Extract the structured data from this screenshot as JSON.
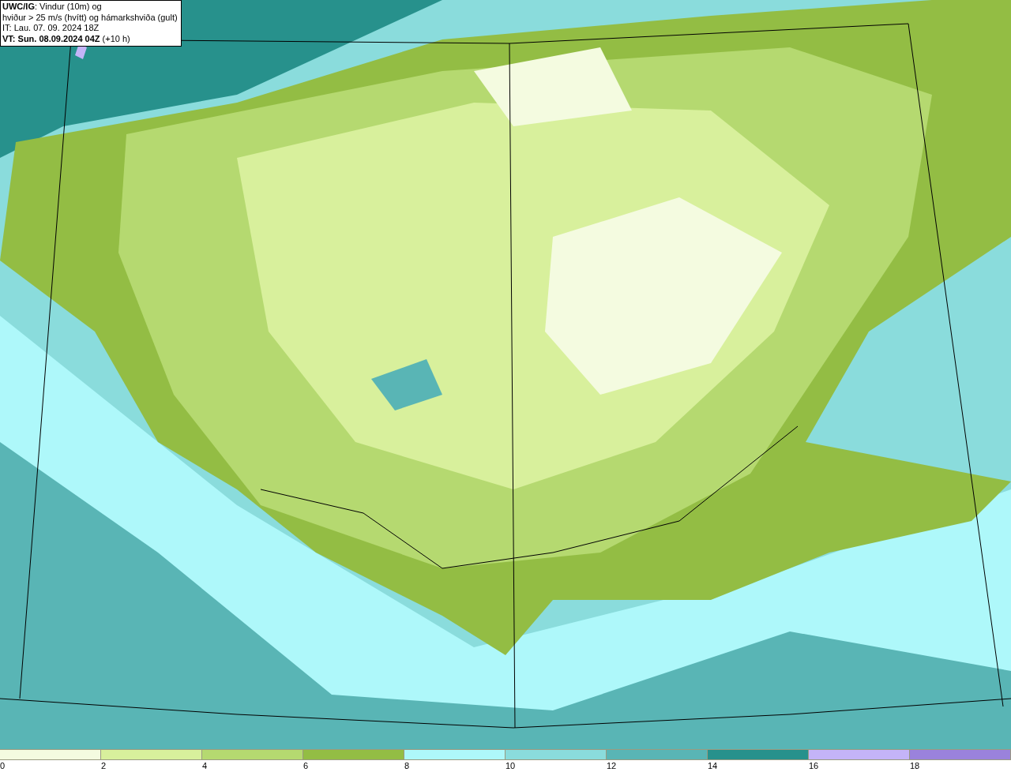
{
  "header": {
    "lines": [
      "**UWC/IG**: Vindur (10m) og",
      "hviður > 25 m/s (hvítt) og hámarkshviða (gult)",
      "IT: Lau. 07. 09. 2024 18Z",
      "**VT: Sun. 08.09.2024 04Z** (+10 h)"
    ]
  },
  "legend": [
    {
      "label": "0",
      "color": "#f4fbe0"
    },
    {
      "label": "2",
      "color": "#d8f09c"
    },
    {
      "label": "4",
      "color": "#b5d970"
    },
    {
      "label": "6",
      "color": "#93bd44"
    },
    {
      "label": "8",
      "color": "#aef8fa"
    },
    {
      "label": "10",
      "color": "#8adcdc"
    },
    {
      "label": "12",
      "color": "#59b5b5"
    },
    {
      "label": "14",
      "color": "#27918c"
    },
    {
      "label": "16",
      "color": "#c4b4f8"
    },
    {
      "label": "18",
      "color": "#9a82dc"
    }
  ]
}
